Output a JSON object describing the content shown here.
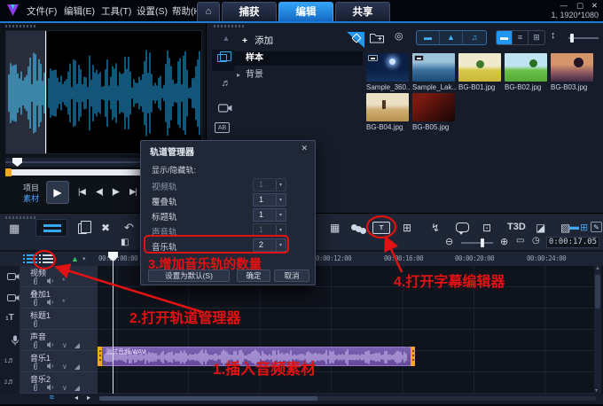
{
  "titlebar": {
    "menus": [
      "文件(F)",
      "编辑(E)",
      "工具(T)",
      "设置(S)",
      "帮助(H)"
    ],
    "tabs": [
      "捕获",
      "编辑",
      "共享"
    ],
    "window_controls": {
      "minimize": "—",
      "maximize": "▢",
      "close": "✕"
    },
    "resolution": "1, 1920*1080"
  },
  "preview": {
    "project_label": "项目",
    "clip_label": "素材"
  },
  "library": {
    "add_label": "添加",
    "folders": [
      "样本",
      "背景"
    ],
    "thumbs": [
      "Sample_360...",
      "Sample_Lak...",
      "BG-B01.jpg",
      "BG-B02.jpg",
      "BG-B03.jpg",
      "BG-B04.jpg",
      "BG-B05.jpg"
    ]
  },
  "toolbar": {
    "time_display": "0:00:17.05",
    "t3d_label": "T3D"
  },
  "timeline": {
    "ruler": [
      "00:00:00:00",
      "00:00:12:00",
      "00:00:16:00",
      "00:00:20:00",
      "00:00:24:00"
    ],
    "tracks": [
      "视频",
      "叠加1",
      "标题1",
      "声音",
      "音乐1",
      "音乐2"
    ],
    "leftcol_digits": [
      "",
      "",
      "1",
      "",
      "1",
      "2"
    ],
    "clip_name": "测试音频.WAV"
  },
  "dialog": {
    "title": "轨道管理器",
    "section": "显示/隐藏轨:",
    "rows": [
      {
        "label": "视频轨",
        "value": "1"
      },
      {
        "label": "覆叠轨",
        "value": "1"
      },
      {
        "label": "标题轨",
        "value": "1"
      },
      {
        "label": "声音轨",
        "value": "1"
      },
      {
        "label": "音乐轨",
        "value": "2"
      }
    ],
    "buttons": [
      "设置为默认(S)",
      "确定",
      "取消"
    ]
  },
  "annotations": [
    "1.插入音频素材",
    "2.打开轨道管理器",
    "3.增加音乐轨的数量",
    "4.打开字幕编辑器"
  ],
  "icons": {
    "home": "⌂",
    "collapse": "▲",
    "music_note": "♬",
    "title_t": "T",
    "expander": "▸",
    "add": "+",
    "play": "▶",
    "go_start": "|◀",
    "prev_frame": "◀|",
    "next_frame": "|▶",
    "go_end": "▶|",
    "repeat": "↻",
    "filter_video": "▬",
    "filter_photo": "▲",
    "filter_music": "♫",
    "view_thumb": "▬",
    "view_list": "≡",
    "view_grid": "⊞",
    "sort": "↕",
    "gear": "◎",
    "storyboard": "▦",
    "tools": "✖",
    "undo": "↶",
    "contrast": "◧",
    "record": "▦",
    "grid": "⊞",
    "motion": "↯",
    "face": "⊡",
    "mask1": "◪",
    "mask2": "▨",
    "zoom_out": "⊖",
    "zoom_in": "⊕",
    "fit": "▭",
    "clock": "◷",
    "caret": "▾",
    "green_tri": "▲",
    "left": "◂",
    "right": "▸",
    "pencil": "✎",
    "ripple": "*",
    "wave_toggle": "∨",
    "fade": "◢",
    "close": "✕",
    "ab_label": "AB",
    "subtitle_label": "T"
  },
  "colors": {
    "accent": "#2196f3",
    "annotation": "#e11212",
    "clip": "#7c60b2",
    "selection": "#f5a623"
  }
}
